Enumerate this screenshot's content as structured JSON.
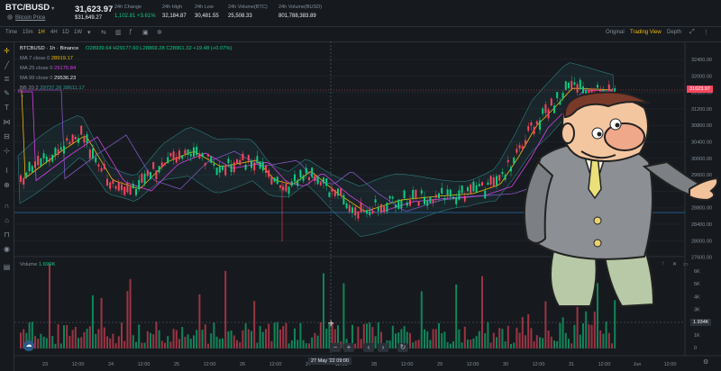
{
  "header": {
    "pair": "BTC/BUSD",
    "pair_sub": "Bitcoin Price",
    "price": "31,623.97",
    "price_usd": "$31,649.27",
    "stats": [
      {
        "label": "24h Change",
        "value": "1,102.81 +3.61%",
        "color": "green"
      },
      {
        "label": "24h High",
        "value": "32,184.87"
      },
      {
        "label": "24h Low",
        "value": "30,481.55"
      },
      {
        "label": "24h Volume(BTC)",
        "value": "25,508.33"
      },
      {
        "label": "24h Volume(BUSD)",
        "value": "801,788,383.89"
      }
    ]
  },
  "toolbar": {
    "intervals": [
      "Time",
      "15m",
      "1H",
      "4H",
      "1D",
      "1W"
    ],
    "active_interval": "1H",
    "views": [
      "Original",
      "Trading View",
      "Depth"
    ],
    "active_view": "Trading View"
  },
  "legend": {
    "title": "BTCBUSD · 1h · Binance",
    "ohlc": "O28939.64 H29177.60 L28869.28 C28961.32 +19.48 (+0.07%)",
    "ma7_label": "MA 7 close 0",
    "ma7_value": "28919.17",
    "ma25_label": "MA 25 close 0",
    "ma25_value": "29175.84",
    "ma99_label": "MA 99 close 0",
    "ma99_value": "29536.23",
    "bb_label": "BB 20 2",
    "bb_value": "29737.26  28611.17",
    "volume_label": "Volume",
    "volume_value": "1.699K"
  },
  "price_axis": [
    "32400.00",
    "32000.00",
    "31600.00",
    "31200.00",
    "30800.00",
    "30400.00",
    "30000.00",
    "29600.00",
    "29200.00",
    "28800.00",
    "28400.00",
    "28000.00",
    "27600.00"
  ],
  "volume_axis": [
    "6K",
    "5K",
    "4K",
    "3K",
    "2K",
    "1K",
    "0"
  ],
  "current_price_tag": "31623.97",
  "volume_tag": "1.934K",
  "time_axis": [
    "23",
    "12:00",
    "24",
    "12:00",
    "25",
    "12:00",
    "26",
    "12:00",
    "27",
    "12:00",
    "28",
    "12:00",
    "29",
    "12:00",
    "30",
    "12:00",
    "31",
    "12:00",
    "Jun",
    "12:00"
  ],
  "crosshair_time": "27 May '22   09:00",
  "colors": {
    "up": "#0ecb81",
    "down": "#f6465d",
    "ma7": "#f0b90b",
    "ma25": "#d63ee8",
    "ma99": "#7e57c2",
    "bb": "#2e7d80",
    "accent": "#f0b90b"
  },
  "icons": [
    "crosshair-icon",
    "trend-line-icon",
    "fib-icon",
    "brush-icon",
    "text-icon",
    "pattern-icon",
    "measure-icon",
    "zoom-icon",
    "magnet-icon",
    "lock-icon",
    "eye-icon",
    "trash-icon"
  ]
}
